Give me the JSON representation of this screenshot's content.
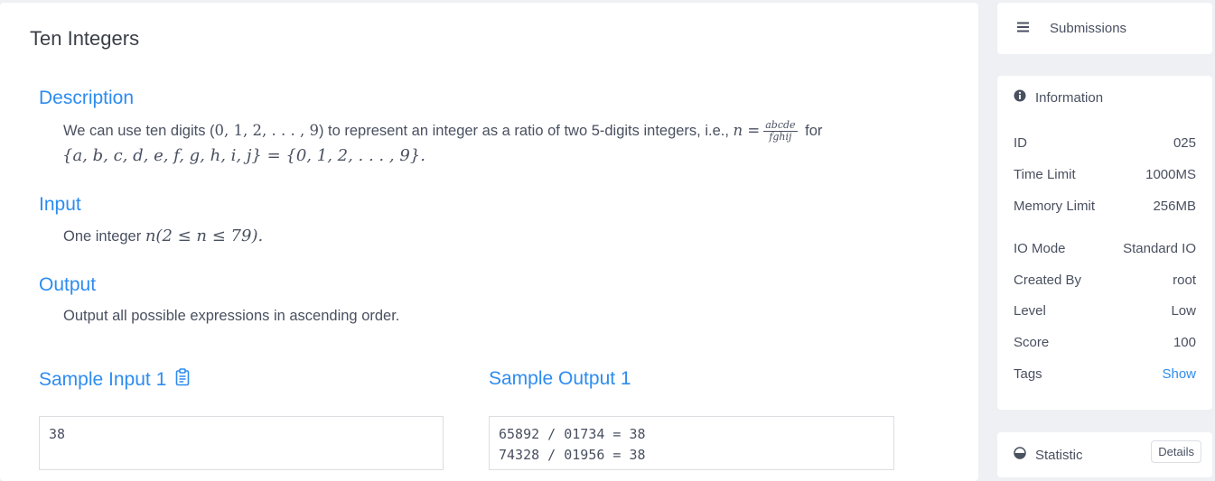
{
  "problem": {
    "title": "Ten Integers",
    "description": {
      "heading": "Description",
      "text_before": "We can use ten digits (",
      "digits": "0, 1, 2, . . . , 9",
      "text_middle": ") to represent an integer as a ratio of two 5-digits integers, i.e., ",
      "n_eq": "n =",
      "frac_num": "abcde",
      "frac_den": "fghij",
      "text_for": "for",
      "line2": "{a, b, c, d, e, f, g, h, i, j} = {0, 1, 2, . . . , 9}."
    },
    "input": {
      "heading": "Input",
      "text": "One integer",
      "math": "n(2 ≤ n ≤ 79)."
    },
    "output": {
      "heading": "Output",
      "text": "Output all possible expressions in ascending order."
    },
    "sample_input": {
      "heading": "Sample Input 1",
      "content": "38"
    },
    "sample_output": {
      "heading": "Sample Output 1",
      "content": "65892 / 01734 = 38\n74328 / 01956 = 38"
    }
  },
  "sidebar": {
    "submissions_label": "Submissions",
    "information": {
      "heading": "Information",
      "rows": [
        {
          "label": "ID",
          "value": "025"
        },
        {
          "label": "Time Limit",
          "value": "1000MS"
        },
        {
          "label": "Memory Limit",
          "value": "256MB"
        },
        {
          "label": "IO Mode",
          "value": "Standard IO"
        },
        {
          "label": "Created By",
          "value": "root"
        },
        {
          "label": "Level",
          "value": "Low"
        },
        {
          "label": "Score",
          "value": "100"
        },
        {
          "label": "Tags",
          "value": "Show"
        }
      ]
    },
    "statistic": {
      "heading": "Statistic",
      "details_label": "Details"
    }
  },
  "colors": {
    "accent": "#2d8cf0",
    "background": "#eef0f3",
    "text": "#495060"
  },
  "icons": [
    "menu-icon",
    "info-icon",
    "copy-icon",
    "pie-chart-icon"
  ]
}
